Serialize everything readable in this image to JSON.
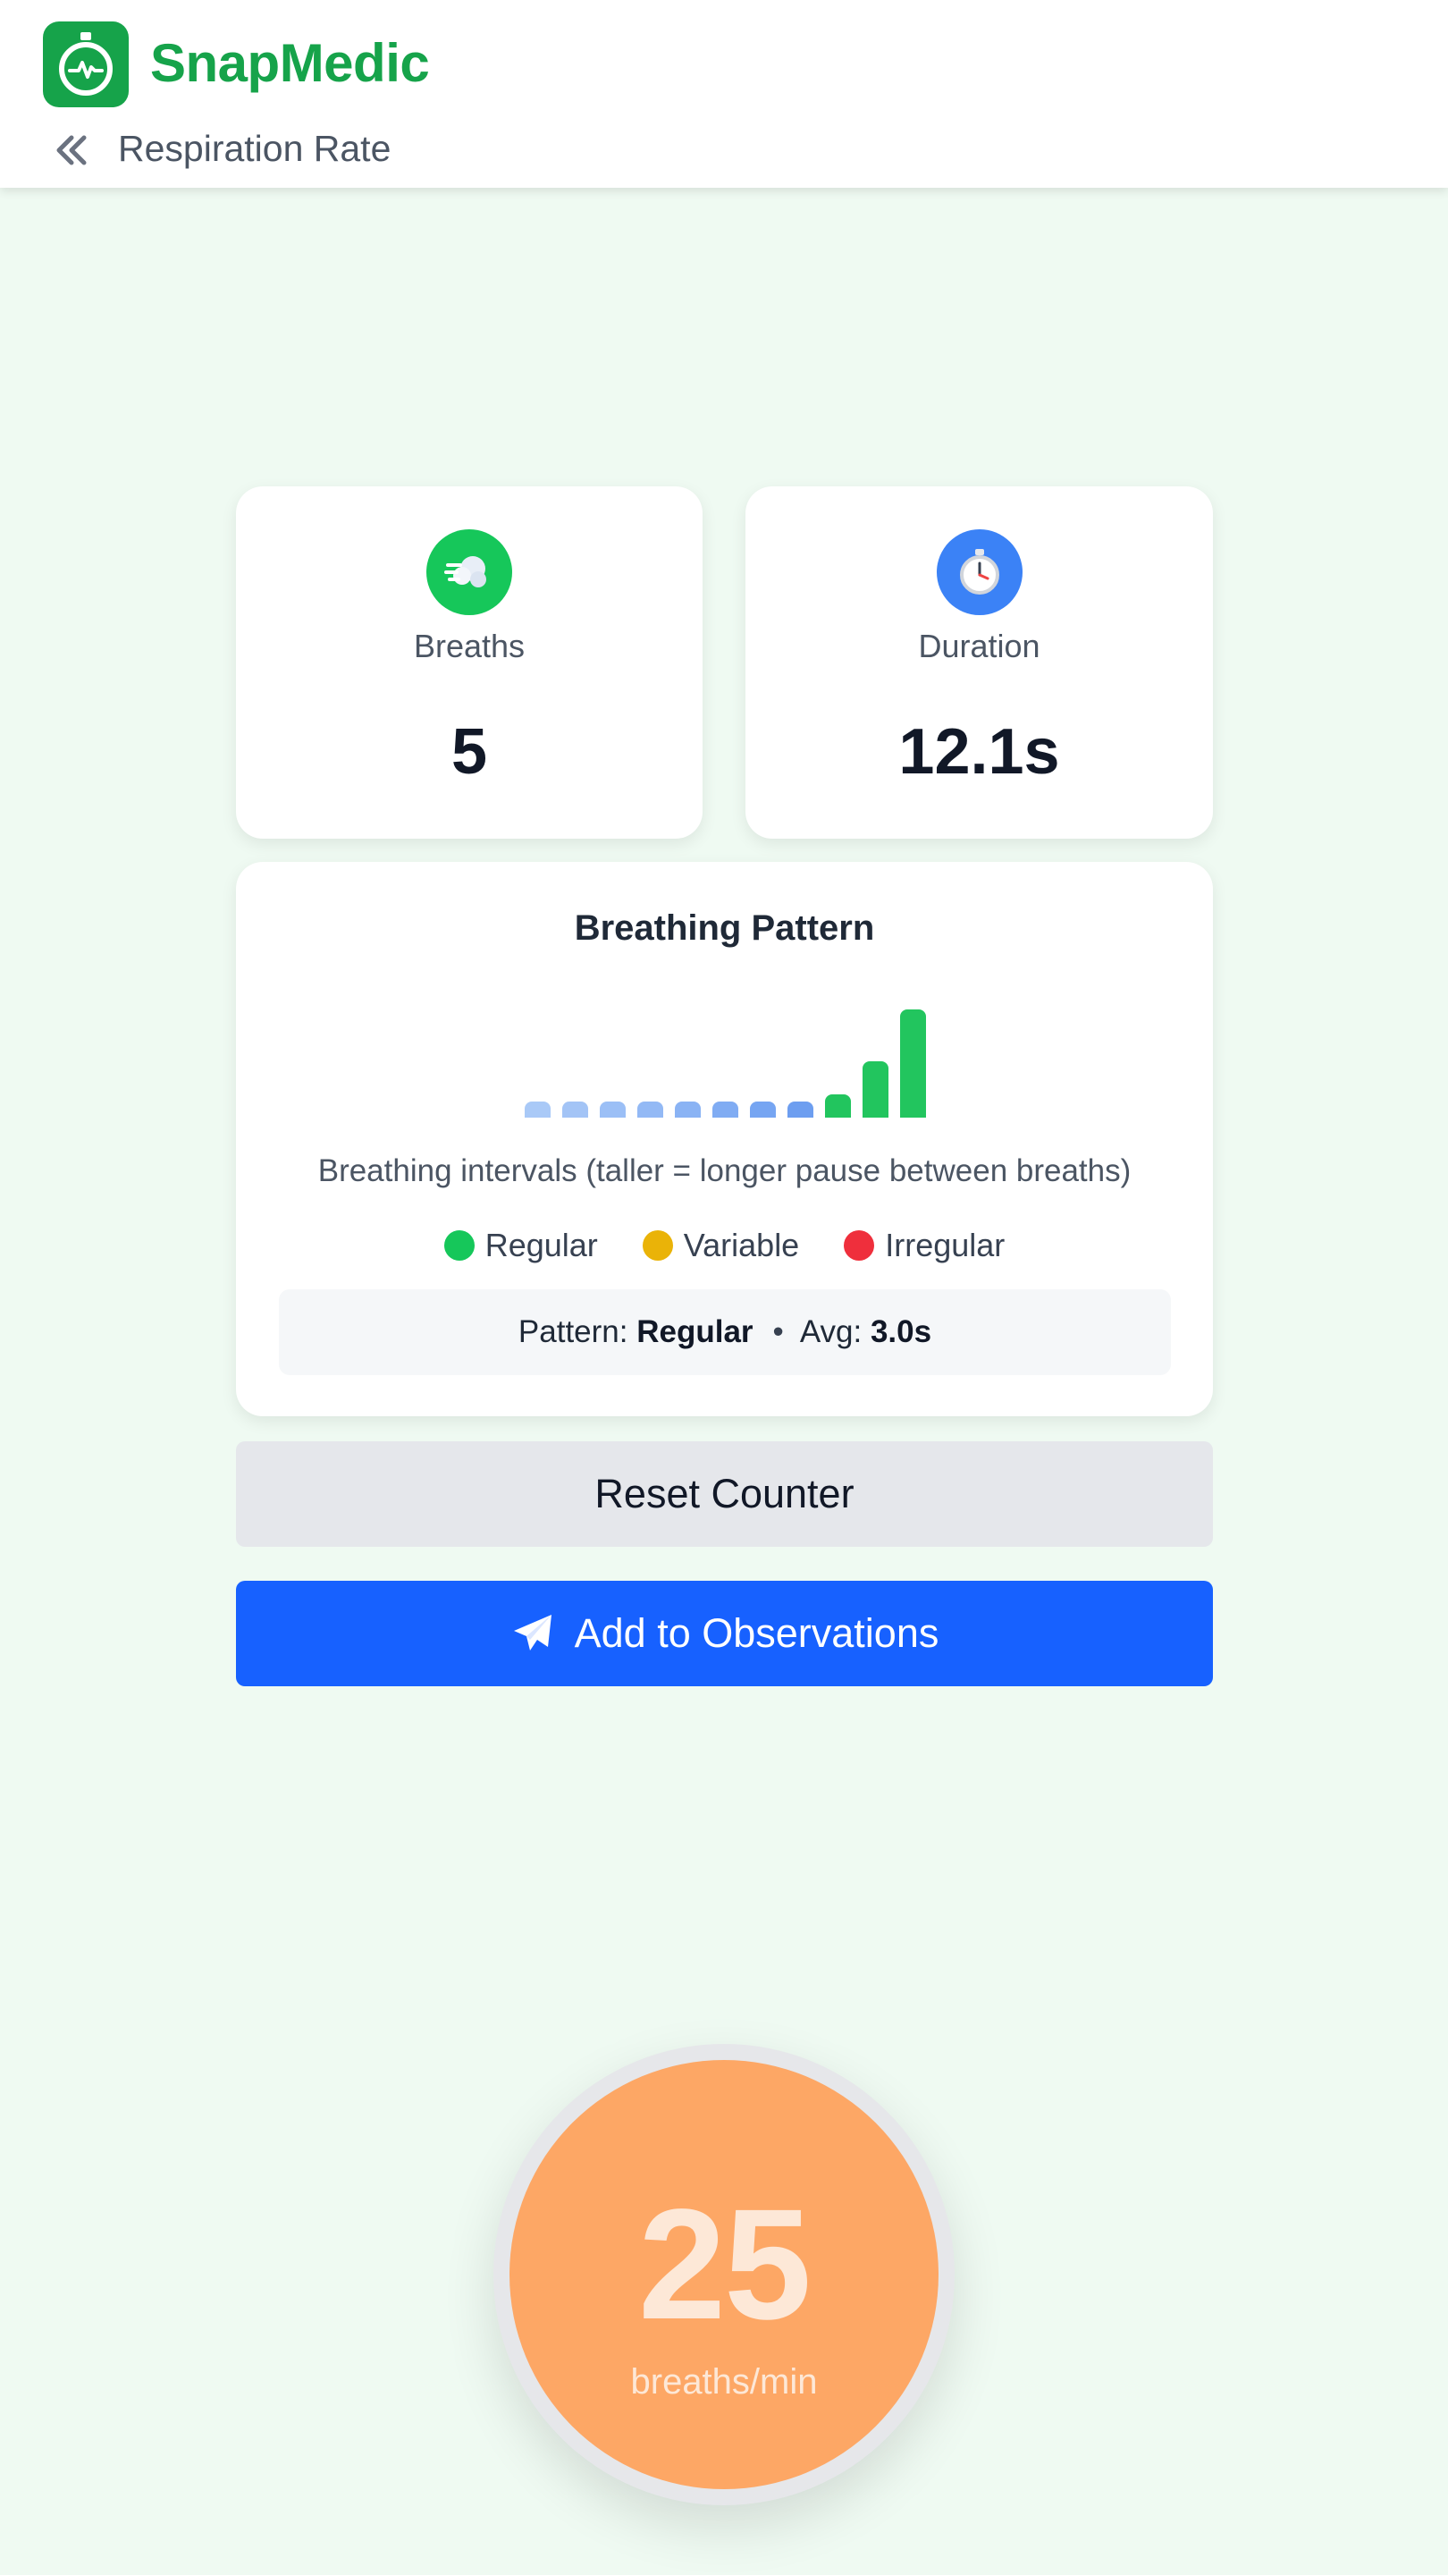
{
  "app": {
    "name": "SnapMedic",
    "logo_icon": "stopwatch-heartbeat-icon",
    "accent": "#16a34a"
  },
  "header": {
    "breadcrumb": "Respiration Rate",
    "back_icon": "double-chevron-left-icon"
  },
  "stats": {
    "breaths": {
      "label": "Breaths",
      "value": "5",
      "icon": "wind-face-icon",
      "icon_color": "#16c75a"
    },
    "duration": {
      "label": "Duration",
      "value": "12.1s",
      "icon": "stopwatch-icon",
      "icon_color": "#3b82f6"
    }
  },
  "pattern": {
    "title": "Breathing Pattern",
    "caption": "Breathing intervals (taller = longer pause between breaths)",
    "legend": [
      {
        "label": "Regular",
        "color": "#16c75a"
      },
      {
        "label": "Variable",
        "color": "#eab308"
      },
      {
        "label": "Irregular",
        "color": "#ef2f3c"
      }
    ],
    "summary_pattern_label": "Pattern:",
    "summary_pattern_value": "Regular",
    "summary_separator": "•",
    "summary_avg_label": "Avg:",
    "summary_avg_value": "3.0s"
  },
  "chart_data": {
    "type": "bar",
    "values": [
      1,
      1,
      1,
      1,
      1,
      1,
      1,
      1,
      2.5,
      6,
      11.5
    ],
    "colors": [
      "#a9c9f7",
      "#a3c4f6",
      "#9bbff6",
      "#93b9f5",
      "#8ab3f4",
      "#80acf3",
      "#76a5f2",
      "#6d9ef0",
      "#22c55e",
      "#22c55e",
      "#22c55e"
    ],
    "title": "",
    "xlabel": "",
    "ylabel": ""
  },
  "buttons": {
    "reset_label": "Reset Counter",
    "add_label": "Add to Observations",
    "add_icon": "paper-plane-icon"
  },
  "rate": {
    "value": "25",
    "unit": "breaths/min",
    "color": "#fda765"
  }
}
